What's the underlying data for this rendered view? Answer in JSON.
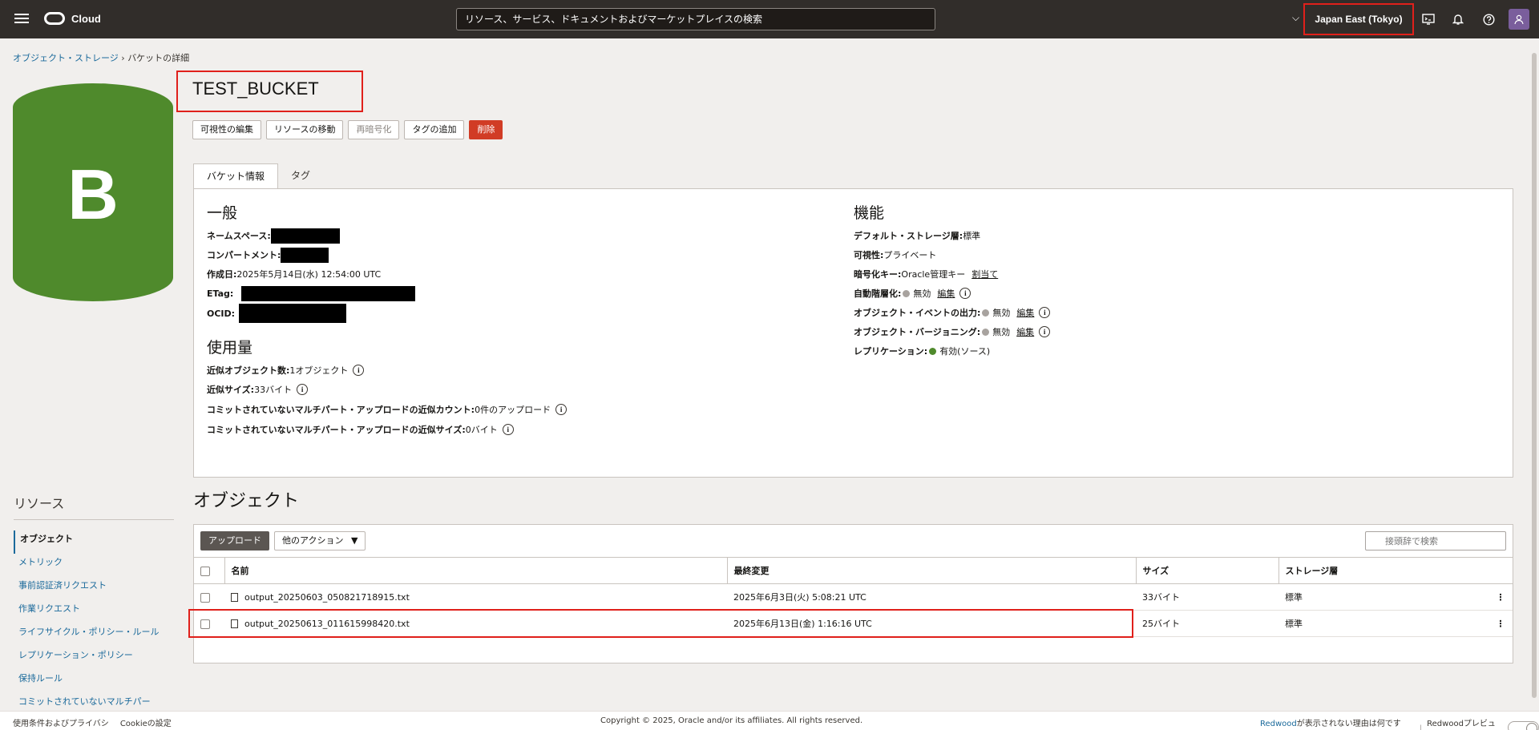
{
  "topbar": {
    "brand": "Cloud",
    "search_placeholder": "リソース、サービス、ドキュメントおよびマーケットプレイスの検索",
    "region": "Japan East (Tokyo)"
  },
  "breadcrumb": {
    "root": "オブジェクト・ストレージ",
    "sep": "›",
    "current": "バケットの詳細"
  },
  "badge_letter": "B",
  "title": "TEST_BUCKET",
  "actions": [
    "可視性の編集",
    "リソースの移動",
    "再暗号化",
    "タグの追加",
    "削除"
  ],
  "tabs": [
    "バケット情報",
    "タグ"
  ],
  "general": {
    "heading": "一般",
    "namespace_label": "ネームスペース:",
    "compartment_label": "コンパートメント:",
    "created_label": "作成日:",
    "created_value": "2025年5月14日(水) 12:54:00 UTC",
    "etag_label": "ETag:",
    "ocid_label": "OCID:"
  },
  "usage": {
    "heading": "使用量",
    "count_label": "近似オブジェクト数:",
    "count_value": "1オブジェクト",
    "size_label": "近似サイズ:",
    "size_value": "33バイト",
    "mp_count_label": "コミットされていないマルチパート・アップロードの近似カウント:",
    "mp_count_value": "0件のアップロード",
    "mp_size_label": "コミットされていないマルチパート・アップロードの近似サイズ:",
    "mp_size_value": "0バイト"
  },
  "features": {
    "heading": "機能",
    "tier_label": "デフォルト・ストレージ層:",
    "tier_value": "標準",
    "visibility_label": "可視性:",
    "visibility_value": "プライベート",
    "key_label": "暗号化キー:",
    "key_value": "Oracle管理キー",
    "key_link": "割当て",
    "autotier_label": "自動階層化:",
    "autotier_value": "無効",
    "events_label": "オブジェクト・イベントの出力:",
    "events_value": "無効",
    "versioning_label": "オブジェクト・バージョニング:",
    "versioning_value": "無効",
    "edit_link": "編集",
    "replication_label": "レプリケーション:",
    "replication_value": "有効(ソース)"
  },
  "resources": {
    "heading": "リソース",
    "items": [
      "オブジェクト",
      "メトリック",
      "事前認証済リクエスト",
      "作業リクエスト",
      "ライフサイクル・ポリシー・ルール",
      "レプリケーション・ポリシー",
      "保持ルール",
      "コミットされていないマルチパー"
    ]
  },
  "objects": {
    "heading": "オブジェクト",
    "upload": "アップロード",
    "more": "他のアクション",
    "filter_placeholder": "接頭辞で検索",
    "columns": [
      "名前",
      "最終変更",
      "サイズ",
      "ストレージ層"
    ],
    "rows": [
      {
        "name": "output_20250603_050821718915.txt",
        "modified": "2025年6月3日(火) 5:08:21 UTC",
        "size": "33バイト",
        "tier": "標準"
      },
      {
        "name": "output_20250613_011615998420.txt",
        "modified": "2025年6月13日(金) 1:16:16 UTC",
        "size": "25バイト",
        "tier": "標準"
      }
    ]
  },
  "footer": {
    "terms": "使用条件およびプライバシ",
    "cookies": "Cookieの設定",
    "copyright": "Copyright © 2025, Oracle and/or its affiliates. All rights reserved.",
    "redwood_link": "Redwood",
    "redwood_text": "が表示されない理由は何ですか。",
    "redwood_preview": "Redwoodプレビュー"
  }
}
